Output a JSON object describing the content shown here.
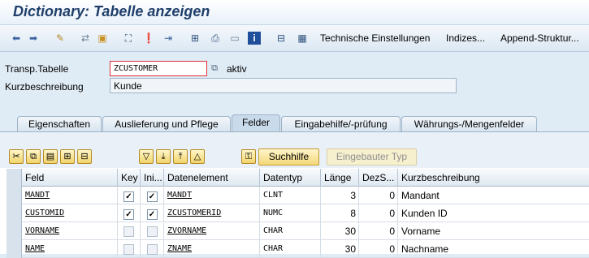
{
  "window": {
    "title": "Dictionary: Tabelle anzeigen"
  },
  "toolbar": {
    "icons": [
      "back-icon",
      "forward-icon",
      "display-change-icon",
      "other-object-icon",
      "active-inactive-icon",
      "where-used-icon",
      "check-icon",
      "activate-icon",
      "navigate-icon",
      "hierarchy-icon",
      "print-icon",
      "layout-icon",
      "info-icon",
      "find-icon",
      "grid-icon"
    ],
    "technische_label": "Technische Einstellungen",
    "indizes_label": "Indizes...",
    "append_label": "Append-Struktur..."
  },
  "form": {
    "table_label": "Transp.Tabelle",
    "table_value": "ZCUSTOMER",
    "status": "aktiv",
    "desc_label": "Kurzbeschreibung",
    "desc_value": "Kunde"
  },
  "tabs": [
    {
      "label": "Eigenschaften",
      "active": false
    },
    {
      "label": "Auslieferung und Pflege",
      "active": false
    },
    {
      "label": "Felder",
      "active": true
    },
    {
      "label": "Eingabehilfe/-prüfung",
      "active": false
    },
    {
      "label": "Währungs-/Mengenfelder",
      "active": false
    }
  ],
  "panel_toolbar": {
    "icons": [
      "cut-icon",
      "copy-icon",
      "paste-icon",
      "insert-row-icon",
      "delete-row-icon",
      "filter-icon",
      "insert-icon",
      "delete-icon",
      "find-icon",
      "key-icon"
    ],
    "suchhilfe_label": "Suchhilfe",
    "eingebauter_label": "Eingebauter Typ"
  },
  "grid": {
    "headers": {
      "feld": "Feld",
      "key": "Key",
      "ini": "Ini...",
      "datenelement": "Datenelement",
      "datentyp": "Datentyp",
      "laenge": "Länge",
      "dezs": "DezS...",
      "kurz": "Kurzbeschreibung"
    },
    "rows": [
      {
        "feld": "MANDT",
        "key": true,
        "ini": true,
        "datenelement": "MANDT",
        "datentyp": "CLNT",
        "laenge": "3",
        "dezs": "0",
        "kurz": "Mandant"
      },
      {
        "feld": "CUSTOMID",
        "key": true,
        "ini": true,
        "datenelement": "ZCUSTOMERID",
        "datentyp": "NUMC",
        "laenge": "8",
        "dezs": "0",
        "kurz": "Kunden ID"
      },
      {
        "feld": "VORNAME",
        "key": false,
        "ini": false,
        "datenelement": "ZVORNAME",
        "datentyp": "CHAR",
        "laenge": "30",
        "dezs": "0",
        "kurz": "Vorname"
      },
      {
        "feld": "NAME",
        "key": false,
        "ini": false,
        "datenelement": "ZNAME",
        "datentyp": "CHAR",
        "laenge": "30",
        "dezs": "0",
        "kurz": "Nachname"
      }
    ]
  }
}
